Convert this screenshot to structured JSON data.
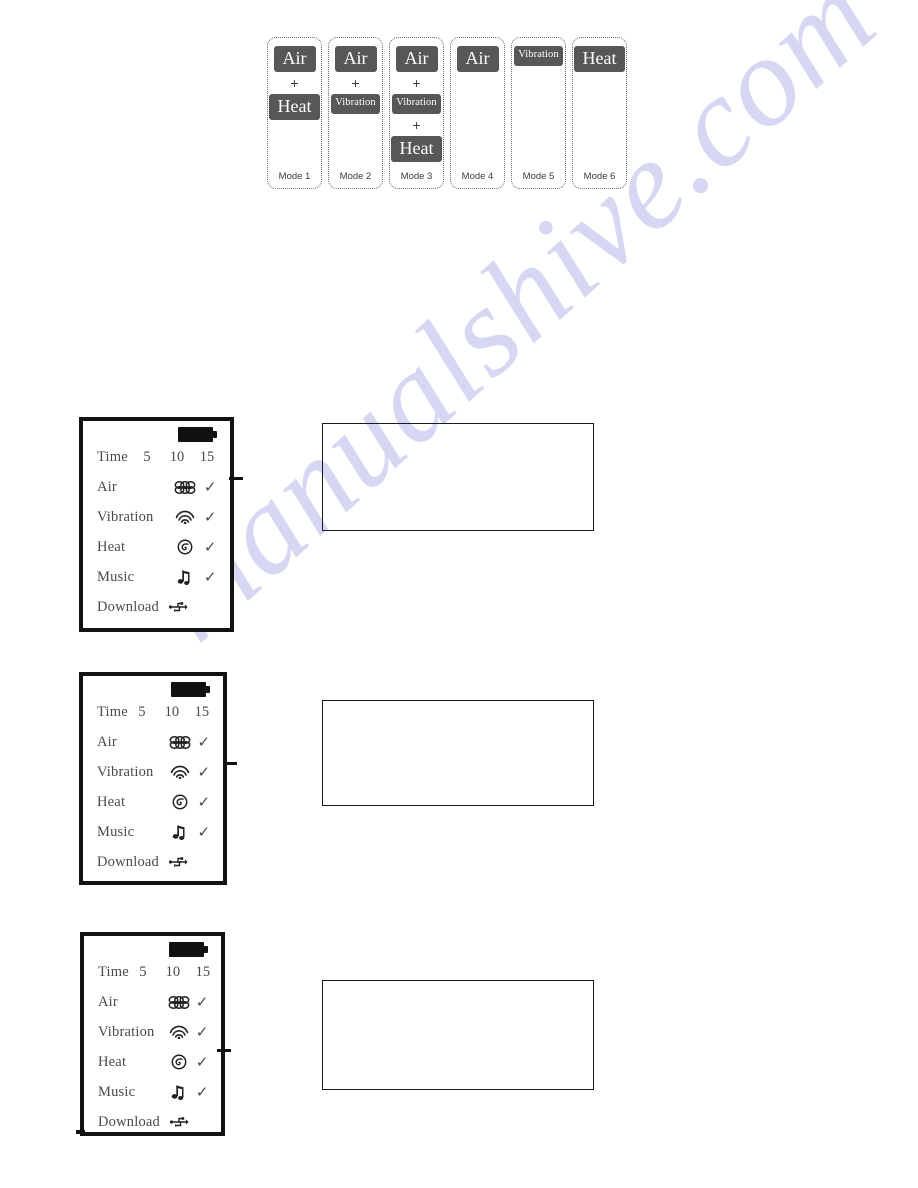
{
  "document": {
    "watermark_text": "manualshive.com",
    "watermark_color": "#d6d7f2"
  },
  "mode_chart": {
    "badge_color": "#575757",
    "badge_text_color": "#ffffff",
    "plus_symbol": "+",
    "cards": [
      {
        "label": "Mode 1",
        "items": [
          {
            "text": "Air",
            "size": "lg"
          },
          {
            "text": "Heat",
            "size": "lg"
          }
        ]
      },
      {
        "label": "Mode 2",
        "items": [
          {
            "text": "Air",
            "size": "lg"
          },
          {
            "text": "Vibration",
            "size": "sm"
          }
        ]
      },
      {
        "label": "Mode 3",
        "items": [
          {
            "text": "Air",
            "size": "lg"
          },
          {
            "text": "Vibration",
            "size": "sm"
          },
          {
            "text": "Heat",
            "size": "lg"
          }
        ]
      },
      {
        "label": "Mode 4",
        "items": [
          {
            "text": "Air",
            "size": "lg"
          }
        ]
      },
      {
        "label": "Mode 5",
        "items": [
          {
            "text": "Vibration",
            "size": "sm"
          }
        ]
      },
      {
        "label": "Mode 6",
        "items": [
          {
            "text": "Heat",
            "size": "lg"
          }
        ]
      }
    ]
  },
  "device_screens": [
    {
      "name": "screen-air-selected",
      "battery": "full",
      "time_label": "Time",
      "time_values": [
        "5",
        "10",
        "15"
      ],
      "rows": [
        {
          "label": "Air",
          "icon": "air-icon",
          "check": "✓"
        },
        {
          "label": "Vibration",
          "icon": "vibration-icon",
          "check": "✓"
        },
        {
          "label": "Heat",
          "icon": "heat-icon",
          "check": "✓"
        },
        {
          "label": "Music",
          "icon": "music-icon",
          "check": "✓"
        }
      ],
      "download_label": "Download",
      "download_icon": "usb-icon",
      "pointer_row": "Air"
    },
    {
      "name": "screen-vibration-selected",
      "battery": "full",
      "time_label": "Time",
      "time_values": [
        "5",
        "10",
        "15"
      ],
      "rows": [
        {
          "label": "Air",
          "icon": "air-icon",
          "check": "✓"
        },
        {
          "label": "Vibration",
          "icon": "vibration-icon",
          "check": "✓"
        },
        {
          "label": "Heat",
          "icon": "heat-icon",
          "check": "✓"
        },
        {
          "label": "Music",
          "icon": "music-icon",
          "check": "✓"
        }
      ],
      "download_label": "Download",
      "download_icon": "usb-icon",
      "pointer_row": "Vibration"
    },
    {
      "name": "screen-heat-selected",
      "battery": "full",
      "time_label": "Time",
      "time_values": [
        "5",
        "10",
        "15"
      ],
      "rows": [
        {
          "label": "Air",
          "icon": "air-icon",
          "check": "✓"
        },
        {
          "label": "Vibration",
          "icon": "vibration-icon",
          "check": "✓"
        },
        {
          "label": "Heat",
          "icon": "heat-icon",
          "check": "✓"
        },
        {
          "label": "Music",
          "icon": "music-icon",
          "check": "✓"
        }
      ],
      "download_label": "Download",
      "download_icon": "usb-icon",
      "pointer_row": "Heat"
    }
  ],
  "caption_boxes": [
    {
      "name": "caption-box-1",
      "text": ""
    },
    {
      "name": "caption-box-2",
      "text": ""
    },
    {
      "name": "caption-box-3",
      "text": ""
    }
  ]
}
